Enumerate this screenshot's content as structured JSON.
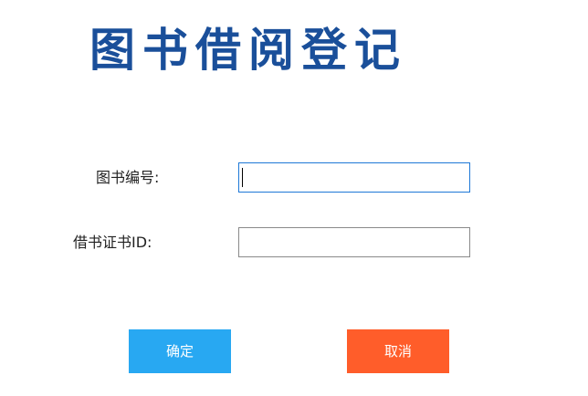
{
  "form": {
    "title": "图书借阅登记",
    "book_id_label": "图书编号:",
    "book_id_value": "",
    "card_id_label": "借书证书ID:",
    "card_id_value": ""
  },
  "buttons": {
    "confirm_label": "确定",
    "cancel_label": "取消"
  },
  "colors": {
    "title": "#1a4f9a",
    "confirm": "#28a8f2",
    "cancel": "#ff5d2a",
    "focus_border": "#1e78d7"
  }
}
